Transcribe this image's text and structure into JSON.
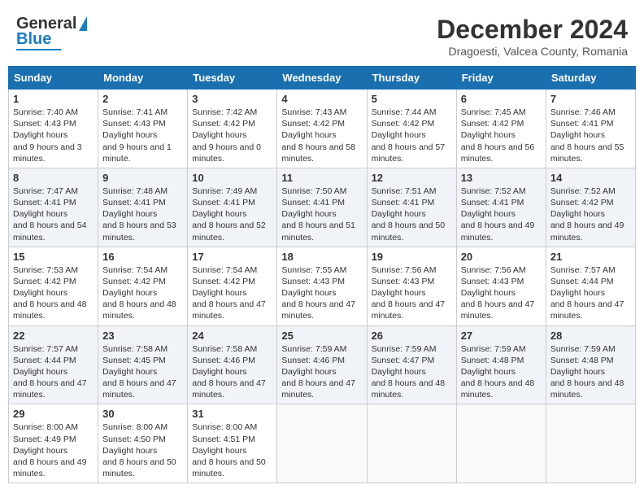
{
  "header": {
    "logo_general": "General",
    "logo_blue": "Blue",
    "month": "December 2024",
    "location": "Dragoesti, Valcea County, Romania"
  },
  "weekdays": [
    "Sunday",
    "Monday",
    "Tuesday",
    "Wednesday",
    "Thursday",
    "Friday",
    "Saturday"
  ],
  "weeks": [
    [
      {
        "day": "1",
        "rise": "7:40 AM",
        "set": "4:43 PM",
        "hours": "9 hours and 3 minutes."
      },
      {
        "day": "2",
        "rise": "7:41 AM",
        "set": "4:43 PM",
        "hours": "9 hours and 1 minute."
      },
      {
        "day": "3",
        "rise": "7:42 AM",
        "set": "4:42 PM",
        "hours": "9 hours and 0 minutes."
      },
      {
        "day": "4",
        "rise": "7:43 AM",
        "set": "4:42 PM",
        "hours": "8 hours and 58 minutes."
      },
      {
        "day": "5",
        "rise": "7:44 AM",
        "set": "4:42 PM",
        "hours": "8 hours and 57 minutes."
      },
      {
        "day": "6",
        "rise": "7:45 AM",
        "set": "4:42 PM",
        "hours": "8 hours and 56 minutes."
      },
      {
        "day": "7",
        "rise": "7:46 AM",
        "set": "4:41 PM",
        "hours": "8 hours and 55 minutes."
      }
    ],
    [
      {
        "day": "8",
        "rise": "7:47 AM",
        "set": "4:41 PM",
        "hours": "8 hours and 54 minutes."
      },
      {
        "day": "9",
        "rise": "7:48 AM",
        "set": "4:41 PM",
        "hours": "8 hours and 53 minutes."
      },
      {
        "day": "10",
        "rise": "7:49 AM",
        "set": "4:41 PM",
        "hours": "8 hours and 52 minutes."
      },
      {
        "day": "11",
        "rise": "7:50 AM",
        "set": "4:41 PM",
        "hours": "8 hours and 51 minutes."
      },
      {
        "day": "12",
        "rise": "7:51 AM",
        "set": "4:41 PM",
        "hours": "8 hours and 50 minutes."
      },
      {
        "day": "13",
        "rise": "7:52 AM",
        "set": "4:41 PM",
        "hours": "8 hours and 49 minutes."
      },
      {
        "day": "14",
        "rise": "7:52 AM",
        "set": "4:42 PM",
        "hours": "8 hours and 49 minutes."
      }
    ],
    [
      {
        "day": "15",
        "rise": "7:53 AM",
        "set": "4:42 PM",
        "hours": "8 hours and 48 minutes."
      },
      {
        "day": "16",
        "rise": "7:54 AM",
        "set": "4:42 PM",
        "hours": "8 hours and 48 minutes."
      },
      {
        "day": "17",
        "rise": "7:54 AM",
        "set": "4:42 PM",
        "hours": "8 hours and 47 minutes."
      },
      {
        "day": "18",
        "rise": "7:55 AM",
        "set": "4:43 PM",
        "hours": "8 hours and 47 minutes."
      },
      {
        "day": "19",
        "rise": "7:56 AM",
        "set": "4:43 PM",
        "hours": "8 hours and 47 minutes."
      },
      {
        "day": "20",
        "rise": "7:56 AM",
        "set": "4:43 PM",
        "hours": "8 hours and 47 minutes."
      },
      {
        "day": "21",
        "rise": "7:57 AM",
        "set": "4:44 PM",
        "hours": "8 hours and 47 minutes."
      }
    ],
    [
      {
        "day": "22",
        "rise": "7:57 AM",
        "set": "4:44 PM",
        "hours": "8 hours and 47 minutes."
      },
      {
        "day": "23",
        "rise": "7:58 AM",
        "set": "4:45 PM",
        "hours": "8 hours and 47 minutes."
      },
      {
        "day": "24",
        "rise": "7:58 AM",
        "set": "4:46 PM",
        "hours": "8 hours and 47 minutes."
      },
      {
        "day": "25",
        "rise": "7:59 AM",
        "set": "4:46 PM",
        "hours": "8 hours and 47 minutes."
      },
      {
        "day": "26",
        "rise": "7:59 AM",
        "set": "4:47 PM",
        "hours": "8 hours and 48 minutes."
      },
      {
        "day": "27",
        "rise": "7:59 AM",
        "set": "4:48 PM",
        "hours": "8 hours and 48 minutes."
      },
      {
        "day": "28",
        "rise": "7:59 AM",
        "set": "4:48 PM",
        "hours": "8 hours and 48 minutes."
      }
    ],
    [
      {
        "day": "29",
        "rise": "8:00 AM",
        "set": "4:49 PM",
        "hours": "8 hours and 49 minutes."
      },
      {
        "day": "30",
        "rise": "8:00 AM",
        "set": "4:50 PM",
        "hours": "8 hours and 50 minutes."
      },
      {
        "day": "31",
        "rise": "8:00 AM",
        "set": "4:51 PM",
        "hours": "8 hours and 50 minutes."
      },
      null,
      null,
      null,
      null
    ]
  ],
  "labels": {
    "sunrise": "Sunrise:",
    "sunset": "Sunset:",
    "daylight": "Daylight hours"
  }
}
